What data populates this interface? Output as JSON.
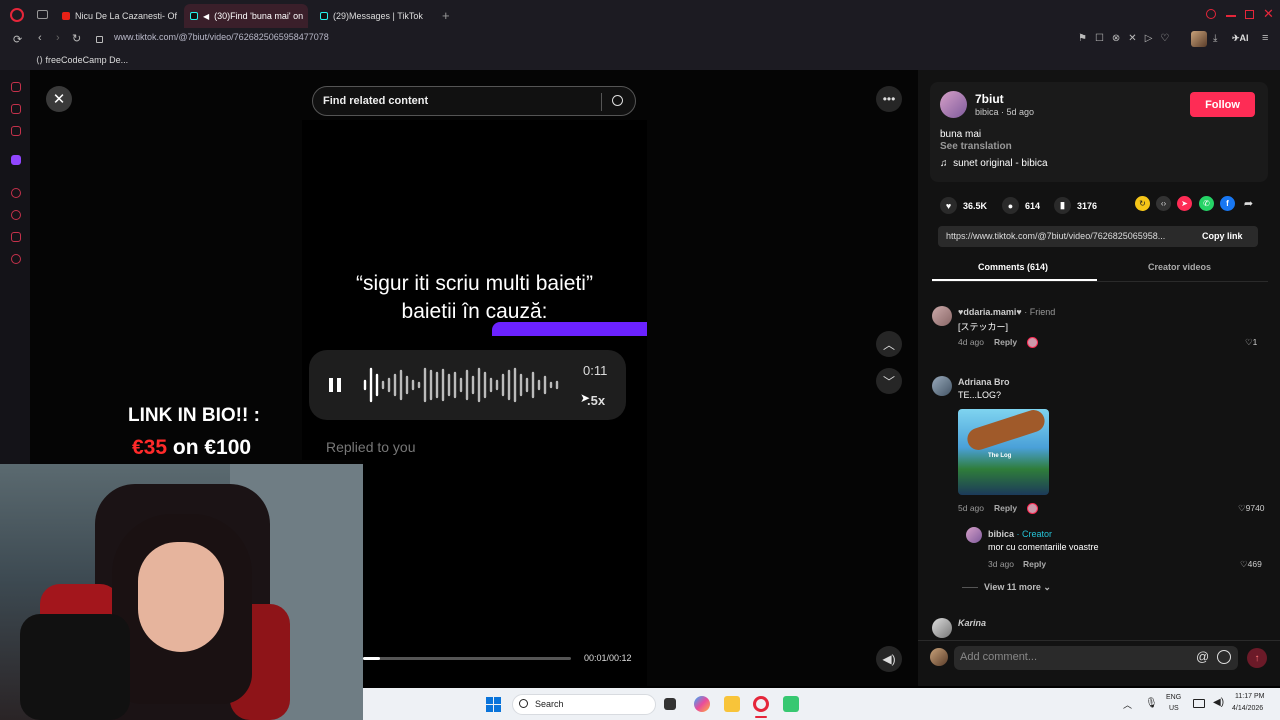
{
  "browser": {
    "tabs": [
      {
        "label": "Nicu De La Cazanesti- Of",
        "icon": "youtube-icon",
        "active": false
      },
      {
        "label": "(30)Find 'buna mai' on",
        "icon": "tiktok-icon",
        "active": true
      },
      {
        "label": "(29)Messages | TikTok",
        "icon": "tiktok-icon",
        "active": false
      }
    ],
    "url": "www.tiktok.com/@7biut/video/7626825065958477078",
    "bookmark": "freeCodeCamp De...",
    "ai_label": "AI"
  },
  "player": {
    "search_placeholder": "Find related content",
    "caption_line1": "“sigur iti scriu multi baieti”",
    "caption_line2": "baietii în cauză:",
    "voice_time": "0:11",
    "voice_speed": ".5x",
    "replied": "Replied to you",
    "time": "00:01/00:12",
    "progress_fraction": 0.08
  },
  "promo": {
    "line1": "LINK IN BIO!! :",
    "price_new": "€35",
    "price_mid": " on ",
    "price_base": "€100"
  },
  "post": {
    "username": "7biut",
    "subline": "bibica · 5d ago",
    "follow": "Follow",
    "description": "buna mai",
    "see_translation": "See translation",
    "sound": "sunet original - bibica",
    "likes": "36.5K",
    "comments": "614",
    "saves": "3176",
    "copy_url": "https://www.tiktok.com/@7biut/video/7626825065958...",
    "copy_link": "Copy link",
    "tab_comments": "Comments (614)",
    "tab_creator": "Creator videos"
  },
  "comments": [
    {
      "name": "♥ddaria.mami♥",
      "tag": " · Friend",
      "text": "[ステッカー]",
      "meta": "4d ago",
      "reply": "Reply",
      "likes": "1"
    },
    {
      "name": "Adriana Bro",
      "tag": "",
      "text": "TE...LOG?",
      "meta": "5d ago",
      "reply": "Reply",
      "likes": "9740",
      "sticker_title": "The Log"
    },
    {
      "name": "bibica",
      "tag": " · Creator",
      "text": "mor cu comentariile voastre",
      "meta": "3d ago",
      "reply": "Reply",
      "likes": "469"
    },
    {
      "name": "Karina",
      "tag": "",
      "text": "",
      "meta": "",
      "reply": "",
      "likes": ""
    }
  ],
  "view_more": "View 11 more",
  "add_comment": "Add comment...",
  "taskbar": {
    "search": "Search",
    "lang1": "ENG",
    "lang2": "US",
    "time": "11:17 PM",
    "date": "4/14/2026"
  }
}
